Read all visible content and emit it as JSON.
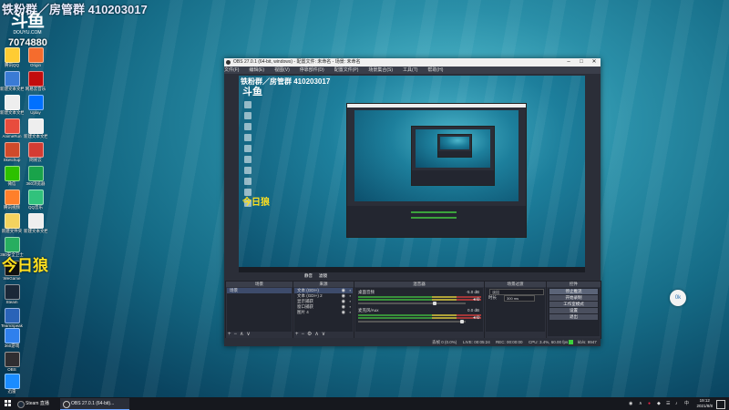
{
  "overlay": {
    "title": "铁粉群／房管群 410203017",
    "logo_big": "斗鱼",
    "logo_sub": "DOUYU.COM",
    "room_id": "7074880",
    "jinri": "今日狼"
  },
  "desktop_icons": [
    {
      "label": "腾讯QQ",
      "color": "#ffcc33"
    },
    {
      "label": "新建文本文档",
      "color": "#3a7bd5"
    },
    {
      "label": "新建文本文档",
      "color": "#eeeeee"
    },
    {
      "label": "AnimeRun",
      "color": "#e84c3d"
    },
    {
      "label": "Sketchup",
      "color": "#d04a2a"
    },
    {
      "label": "微信",
      "color": "#2dc100"
    },
    {
      "label": "腾讯视频",
      "color": "#ff7f2a"
    },
    {
      "label": "新建文件夹",
      "color": "#f4d35e"
    },
    {
      "label": "360安全卫士",
      "color": "#27ae60"
    },
    {
      "label": "WeGame",
      "color": "#111111"
    },
    {
      "label": "Steam",
      "color": "#1b2838"
    },
    {
      "label": "TeamSpeak",
      "color": "#2a63b8"
    },
    {
      "label": "Origin",
      "color": "#f56c2d"
    },
    {
      "label": "网易云音乐",
      "color": "#c20c0c"
    },
    {
      "label": "Uplay",
      "color": "#0070ff"
    },
    {
      "label": "新建文本文档",
      "color": "#eeeeee"
    },
    {
      "label": "网易云",
      "color": "#d43c33"
    },
    {
      "label": "360浏览器",
      "color": "#19a34a"
    },
    {
      "label": "QQ音乐",
      "color": "#31c27c"
    },
    {
      "label": "新建文本文档",
      "color": "#eeeeee"
    },
    {
      "label": "360游戏",
      "color": "#2f80ed"
    },
    {
      "label": "OBS",
      "color": "#302e31"
    },
    {
      "label": "迅雷",
      "color": "#1a8cff"
    },
    {
      "label": "网易UU",
      "color": "#e53935"
    }
  ],
  "obs": {
    "title": "OBS 27.0.1 (64-bit, windows) - 配置文件: 未命名 - 场景: 未命名",
    "menu": [
      "文件(F)",
      "编辑(E)",
      "视图(V)",
      "停靠部件(D)",
      "配置文件(P)",
      "场景集合(S)",
      "工具(T)",
      "帮助(H)"
    ],
    "preview_bar": {
      "left": "静音",
      "right": "滤镜"
    },
    "docks": {
      "scenes": {
        "title": "场景",
        "items": [
          "场景"
        ]
      },
      "sources": {
        "title": "来源",
        "items": [
          "文本 (GDI+)",
          "文本 (GDI+) 2",
          "显示捕获",
          "窗口捕获",
          "图片 4"
        ]
      },
      "mixer": {
        "title": "混音器",
        "channels": [
          {
            "name": "桌面音频",
            "db": "-5.0 dB"
          },
          {
            "name": "麦克风/Aux",
            "db": "0.0 dB"
          }
        ]
      },
      "transitions": {
        "title": "场景过渡",
        "type": "淡出",
        "duration_label": "时长",
        "duration": "300 ms"
      },
      "controls": {
        "title": "控件",
        "buttons": [
          "停止推流",
          "开始录制",
          "工作室模式",
          "设置",
          "退出"
        ]
      }
    },
    "status": {
      "dropped": "丢帧 0 (0.0%)",
      "live": "LIVE: 00:05:24",
      "rec": "REC: 00:00:00",
      "cpu": "CPU: 3.4%, 60.00 fps",
      "kbps": "kb/s: 9947"
    }
  },
  "taskbar": {
    "items": [
      {
        "label": "Steam 直播",
        "color": "#1b2838"
      },
      {
        "label": "OBS 27.0.1 (64-bit)...",
        "color": "#302e31"
      }
    ],
    "time": "19:12",
    "date": "2021/8/8"
  },
  "floating": {
    "right_button": "0k"
  }
}
